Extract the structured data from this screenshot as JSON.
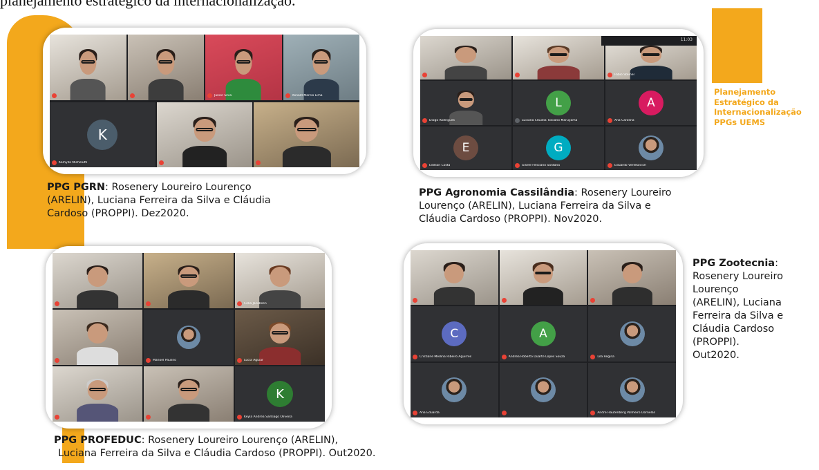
{
  "header": {
    "text": "planejamento estratégico da internacionalização."
  },
  "brand": {
    "lines": [
      "Planejamento",
      "Estratégico da",
      "Internacionalização",
      "PPGs UEMS"
    ]
  },
  "colors": {
    "accent": "#f3a81c",
    "meet_bg": "#1e1f22",
    "mic_off": "#e94235"
  },
  "meetings": {
    "pgrn": {
      "caption_title": "PPG PGRN",
      "caption_lines": [
        ":  Rosenery Loureiro Lourenço",
        "(ARELIN), Luciana Ferreira da Silva e Cláudia",
        "Cardoso (PROPPI). Dez2020."
      ],
      "tiles": [
        {
          "label": ""
        },
        {
          "label": ""
        },
        {
          "label": "Junior Silva"
        },
        {
          "label": "Ronald Marcio Lima"
        },
        {
          "label": "Kamylla Michelutti",
          "avatar_letter": "K",
          "avatar_color": "#4b5d6b"
        },
        {
          "label": ""
        },
        {
          "label": ""
        }
      ]
    },
    "agronomia": {
      "caption_title": "PPG Agronomia Cassilândia",
      "caption_lines": [
        ":  Rosenery Loureiro",
        "Lourenço (ARELIN), Luciana Ferreira da Silva e",
        "Cláudia Cardoso (PROPPI). Nov2020."
      ],
      "status": "11:03",
      "tiles": [
        {
          "label": ""
        },
        {
          "label": ""
        },
        {
          "label": "Fábio Steiner"
        },
        {
          "label": "Diogo Rodrigues"
        },
        {
          "label": "Luciana Claudia Toscano Maruyama",
          "avatar_letter": "L",
          "avatar_color": "#43a047"
        },
        {
          "label": "Ana Carolina",
          "avatar_letter": "A",
          "avatar_color": "#d81b60"
        },
        {
          "label": "Edilson Costa",
          "avatar_letter": "E",
          "avatar_color": "#6d4c41"
        },
        {
          "label": "Gisele Feliciano Santana",
          "avatar_letter": "G",
          "avatar_color": "#00acc1"
        },
        {
          "label": "Eduardo Verlekovich"
        }
      ]
    },
    "profeduc": {
      "caption_title": "PPG PROFEDUC",
      "caption_lines": [
        ":  Rosenery Loureiro Lourenço (ARELIN),",
        "Luciana Ferreira da Silva e Cláudia Cardoso (PROPPI). Out2020."
      ],
      "tiles": [
        {
          "label": ""
        },
        {
          "label": ""
        },
        {
          "label": "Célia Jacobsen"
        },
        {
          "label": ""
        },
        {
          "label": "Manoel Paulino"
        },
        {
          "label": "Lúcia Aguiar"
        },
        {
          "label": ""
        },
        {
          "label": ""
        },
        {
          "label": "Keyla Andrea Santiago Oliveira",
          "avatar_letter": "K",
          "avatar_color": "#2e7d32"
        }
      ]
    },
    "zootecnia": {
      "caption_title": "PPG Zootecnia",
      "caption_lines": [
        ":",
        "Rosenery Loureiro",
        "Lourenço",
        "(ARELIN), Luciana",
        "Ferreira da Silva e",
        "Cláudia Cardoso",
        "(PROPPI).",
        "Out2020."
      ],
      "tiles": [
        {
          "label": ""
        },
        {
          "label": ""
        },
        {
          "label": ""
        },
        {
          "label": "Cristiane Medina Ribeiro Aguirres",
          "avatar_letter": "C",
          "avatar_color": "#5c6bc0"
        },
        {
          "label": "Andrea Roberto Duarte Lopes Souza",
          "avatar_letter": "A",
          "avatar_color": "#43a047"
        },
        {
          "label": "Lila Regina"
        },
        {
          "label": "Ana Eduarda"
        },
        {
          "label": ""
        },
        {
          "label": "Andre Hautenberg Palmeiro Dornelas"
        }
      ]
    }
  }
}
